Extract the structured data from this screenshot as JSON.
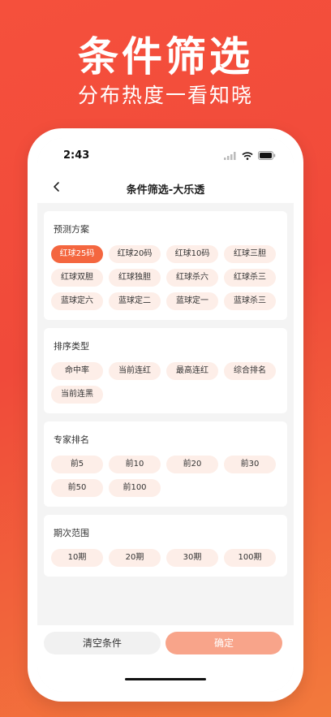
{
  "promo": {
    "title": "条件筛选",
    "subtitle": "分布热度一看知晓"
  },
  "status_bar": {
    "time": "2:43",
    "icons": [
      "signal-icon",
      "wifi-icon",
      "battery-icon"
    ]
  },
  "nav": {
    "title": "条件筛选-大乐透",
    "back_icon": "chevron-left-icon"
  },
  "sections": [
    {
      "title": "预测方案",
      "options": [
        "红球25码",
        "红球20码",
        "红球10码",
        "红球三胆",
        "红球双胆",
        "红球独胆",
        "红球杀六",
        "红球杀三",
        "蓝球定六",
        "蓝球定二",
        "蓝球定一",
        "蓝球杀三"
      ],
      "selected": "红球25码"
    },
    {
      "title": "排序类型",
      "options": [
        "命中率",
        "当前连红",
        "最高连红",
        "综合排名",
        "当前连黑"
      ]
    },
    {
      "title": "专家排名",
      "options": [
        "前5",
        "前10",
        "前20",
        "前30",
        "前50",
        "前100"
      ]
    },
    {
      "title": "期次范围",
      "options": [
        "10期",
        "20期",
        "30期",
        "100期"
      ]
    }
  ],
  "buttons": {
    "clear": "清空条件",
    "confirm": "确定"
  },
  "colors": {
    "accent": "#f4663f",
    "chip_bg": "#fdeee8",
    "confirm_bg": "#f8a48a",
    "promo_bg": "#f04a3a"
  }
}
